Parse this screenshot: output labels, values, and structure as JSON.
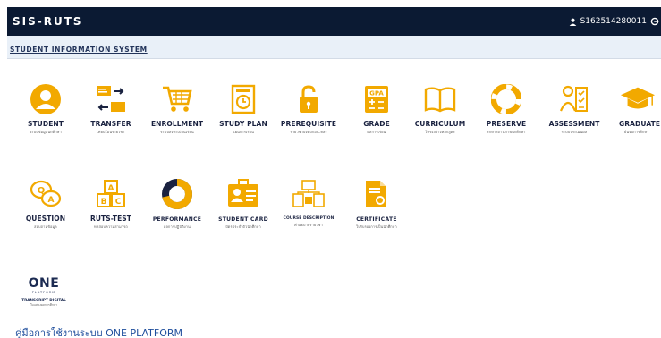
{
  "app": {
    "title": "SIS-RUTS",
    "subtitle": "STUDENT INFORMATION SYSTEM"
  },
  "user": {
    "id": "S162514280011",
    "icon": "user-icon",
    "menu_icon": "settings-icon"
  },
  "tiles": [
    {
      "key": "student",
      "label": "STUDENT",
      "sub": "ระบบข้อมูลนักศึกษา",
      "icon": "student-icon"
    },
    {
      "key": "transfer",
      "label": "TRANSFER",
      "sub": "เทียบโอนรายวิชา",
      "icon": "transfer-icon"
    },
    {
      "key": "enrollment",
      "label": "ENROLLMENT",
      "sub": "ระบบลงทะเบียนเรียน",
      "icon": "cart-icon"
    },
    {
      "key": "study-plan",
      "label": "STUDY PLAN",
      "sub": "แผนการเรียน",
      "icon": "study-plan-icon"
    },
    {
      "key": "prerequisite",
      "label": "PREREQUISITE",
      "sub": "รายวิชาบังคับก่อน-หลัง",
      "icon": "lock-icon"
    },
    {
      "key": "grade",
      "label": "GRADE",
      "sub": "ผลการเรียน",
      "icon": "gpa-icon"
    },
    {
      "key": "curriculum",
      "label": "CURRICULUM",
      "sub": "โครงสร้างหลักสูตร",
      "icon": "book-icon"
    },
    {
      "key": "preserve",
      "label": "PRESERVE",
      "sub": "รักษาสถานภาพนักศึกษา",
      "icon": "lifebuoy-icon"
    },
    {
      "key": "assessment",
      "label": "ASSESSMENT",
      "sub": "ระบบประเมินผล",
      "icon": "assessment-icon"
    },
    {
      "key": "graduate",
      "label": "GRADUATE",
      "sub": "ยื่นจบการศึกษา",
      "icon": "graduation-cap-icon"
    },
    {
      "key": "question",
      "label": "QUESTION",
      "sub": "สอบถามข้อมูล",
      "icon": "question-bubbles-icon"
    },
    {
      "key": "ruts-test",
      "label": "RUTS-TEST",
      "sub": "ทดสอบความสามารถ",
      "icon": "abc-blocks-icon"
    },
    {
      "key": "performance",
      "label": "PERFORMANCE",
      "sub": "ผลการปฏิบัติงาน",
      "icon": "donut-chart-icon"
    },
    {
      "key": "student-card",
      "label": "STUDENT CARD",
      "sub": "บัตรประจำตัวนักศึกษา",
      "icon": "id-card-icon"
    },
    {
      "key": "course-description",
      "label": "COURSE DESCRIPTION",
      "sub": "คำอธิบายรายวิชา",
      "icon": "course-description-icon"
    },
    {
      "key": "certificate",
      "label": "CERTIFICATE",
      "sub": "ใบรับรองการเป็นนักศึกษา",
      "icon": "certificate-icon"
    }
  ],
  "one_platform": {
    "logo": "ONE",
    "logo_sub": "PLATFORM",
    "label": "TRANSCRIPT DIGITAL",
    "sub": "ใบแสดงผลการศึกษา",
    "icon": "one-platform-logo"
  },
  "manual_link": "คู่มือการใช้งานระบบ ONE PLATFORM",
  "colors": {
    "accent": "#f2a900",
    "navy": "#0b1a33",
    "text": "#1a2240",
    "link": "#1f4e9c"
  }
}
